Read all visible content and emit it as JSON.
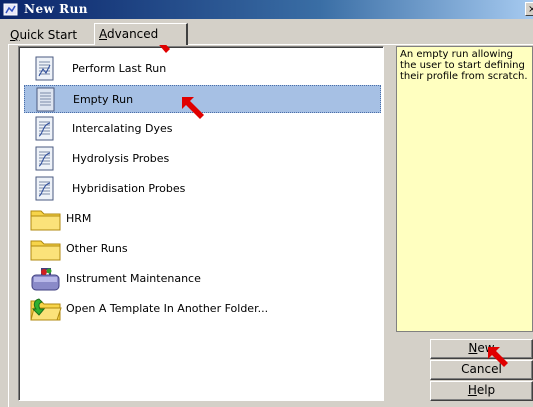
{
  "window": {
    "title": "New Run",
    "close_glyph": "×"
  },
  "tabs": [
    {
      "label_html_prefix": "",
      "underline": "Q",
      "rest": "uick Start"
    },
    {
      "underline": "A",
      "rest": "dvanced"
    }
  ],
  "runs": [
    {
      "label": "Perform Last Run",
      "icon": "document-icon"
    },
    {
      "label": "Empty Run",
      "icon": "document-icon",
      "selected": true
    },
    {
      "label": "Intercalating Dyes",
      "icon": "document-icon"
    },
    {
      "label": "Hydrolysis Probes",
      "icon": "document-icon"
    },
    {
      "label": "Hybridisation Probes",
      "icon": "document-icon"
    },
    {
      "label": "HRM",
      "icon": "folder-icon"
    },
    {
      "label": "Other Runs",
      "icon": "folder-icon"
    },
    {
      "label": "Instrument Maintenance",
      "icon": "toolbox-icon"
    },
    {
      "label": "Open A Template In Another Folder...",
      "icon": "folder-open-icon"
    }
  ],
  "description": "An empty run allowing the user to start defining their profile from scratch.",
  "buttons": {
    "new": {
      "underline": "N",
      "rest": "ew"
    },
    "cancel": "Cancel",
    "help": {
      "underline": "H",
      "rest": "elp"
    }
  },
  "colors": {
    "title_gradient_start": "#0a246a",
    "selection": "#a6c0e4",
    "description_bg": "#ffffc0",
    "annotation_arrow": "#e00000"
  }
}
